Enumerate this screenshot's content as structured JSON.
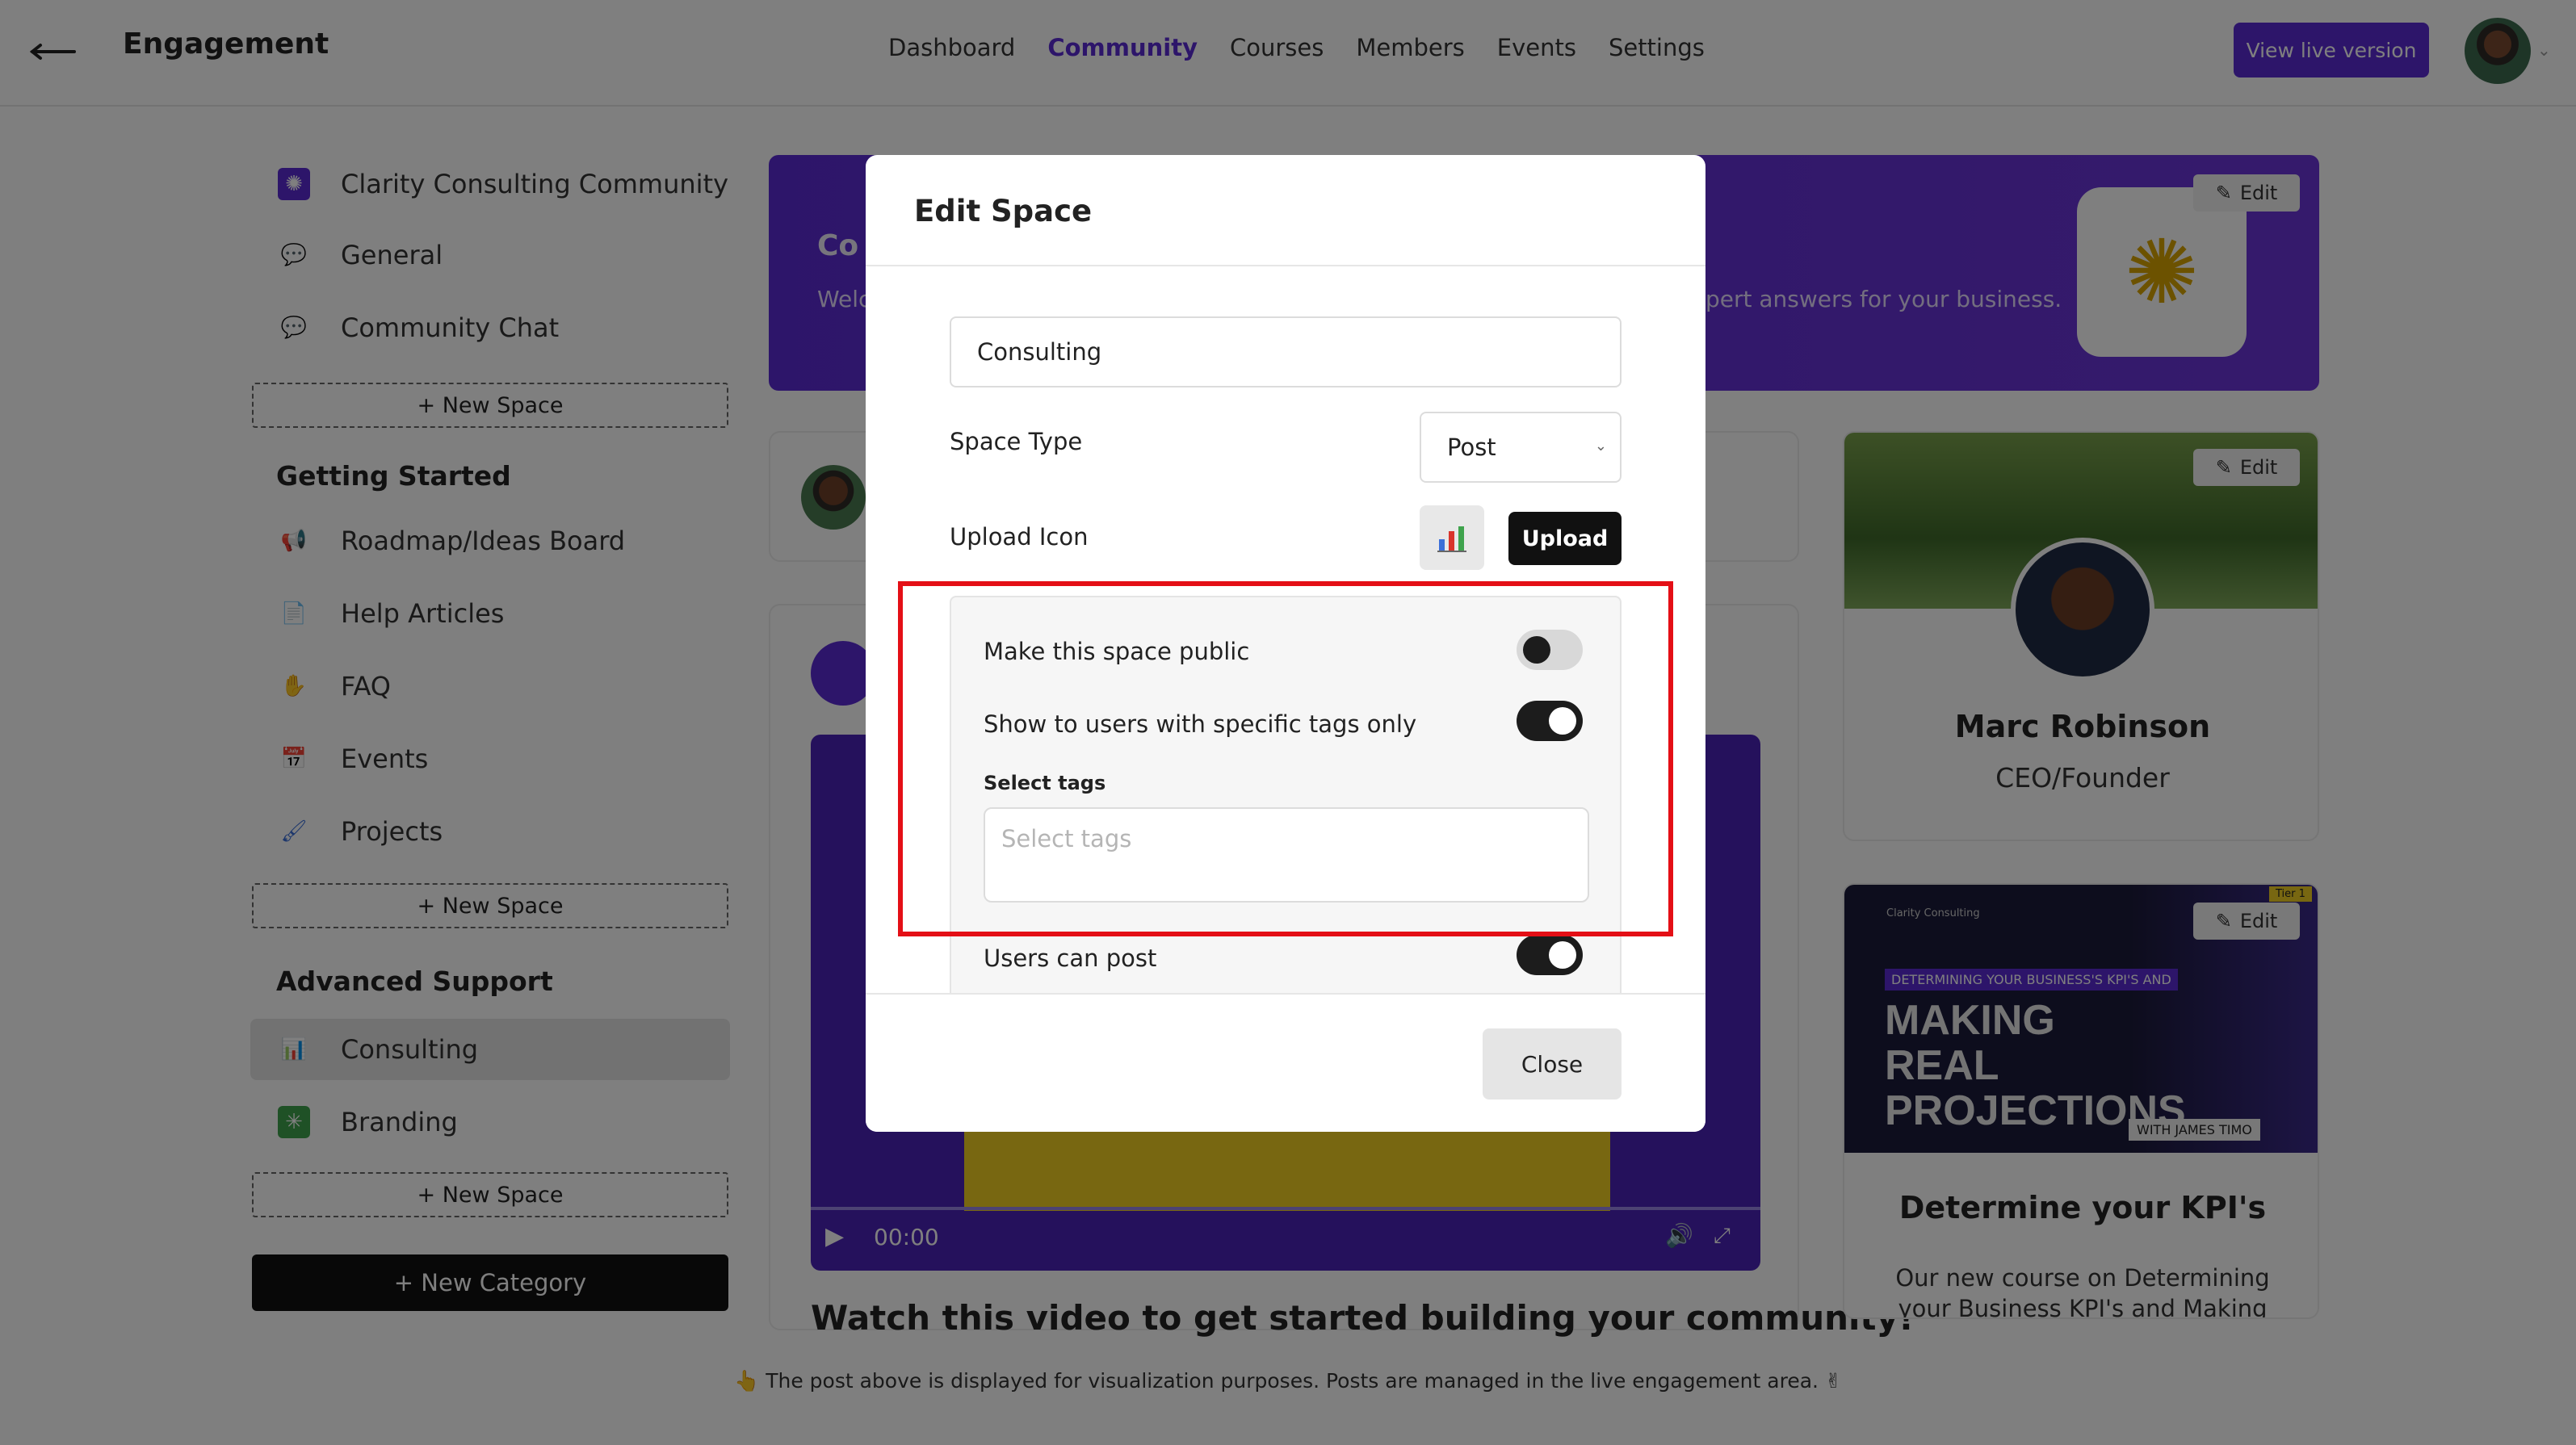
{
  "header": {
    "title": "Engagement",
    "nav": [
      "Dashboard",
      "Community",
      "Courses",
      "Members",
      "Events",
      "Settings"
    ],
    "active_nav": "Community",
    "live_button": "View live version"
  },
  "sidebar": {
    "top_items": [
      {
        "label": "Clarity Consulting Community",
        "icon": "gear-icon"
      },
      {
        "label": "General",
        "icon": "chat-bubble-icon"
      },
      {
        "label": "Community Chat",
        "icon": "chat-bubble-icon"
      }
    ],
    "new_space": "+ New Space",
    "sections": [
      {
        "heading": "Getting Started",
        "items": [
          {
            "label": "Roadmap/Ideas Board",
            "icon": "megaphone-icon"
          },
          {
            "label": "Help Articles",
            "icon": "document-icon"
          },
          {
            "label": "FAQ",
            "icon": "hand-icon"
          },
          {
            "label": "Events",
            "icon": "calendar-icon"
          },
          {
            "label": "Projects",
            "icon": "paintbrush-icon"
          }
        ]
      },
      {
        "heading": "Advanced Support",
        "items": [
          {
            "label": "Consulting",
            "icon": "bar-chart-icon",
            "selected": true
          },
          {
            "label": "Branding",
            "icon": "sparkle-icon"
          }
        ]
      }
    ],
    "new_category": "+ New Category"
  },
  "banner": {
    "title_partial": "Co",
    "subtitle_partial": "Welc",
    "subtitle_tail": "pert answers for your business.",
    "edit": "Edit"
  },
  "profile": {
    "name": "Marc Robinson",
    "role": "CEO/Founder",
    "edit": "Edit"
  },
  "course": {
    "brand": "Clarity Consulting",
    "tier": "Tier 1",
    "small_headline": "DETERMINING YOUR BUSINESS'S KPI'S AND",
    "big_headline": "MAKING REAL PROJECTIONS",
    "with": "WITH JAMES TIMO",
    "title": "Determine your KPI's",
    "description": "Our new course on Determining your Business KPI's and Making",
    "edit": "Edit"
  },
  "video": {
    "time": "00:00",
    "caption": "Watch this video to get started building your community!"
  },
  "footer_note": "👆 The post above is displayed for visualization purposes. Posts are managed in the live engagement area. ✌",
  "modal": {
    "title": "Edit Space",
    "space_name": "Consulting",
    "space_type_label": "Space Type",
    "space_type_value": "Post",
    "upload_icon_label": "Upload Icon",
    "upload_button": "Upload",
    "toggles": [
      {
        "label": "Make this space public",
        "on": false
      },
      {
        "label": "Show to users with specific tags only",
        "on": true
      },
      {
        "label": "Users can post",
        "on": true
      }
    ],
    "select_tags_label": "Select tags",
    "select_tags_placeholder": "Select tags",
    "close_button": "Close"
  },
  "colors": {
    "accent": "#5b2bd4",
    "highlight": "#e40f16"
  }
}
